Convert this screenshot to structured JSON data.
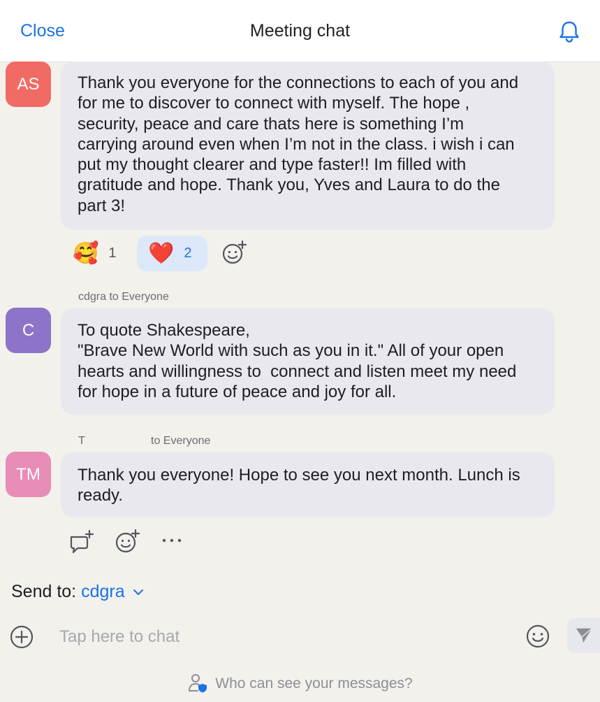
{
  "header": {
    "close_label": "Close",
    "title": "Meeting chat",
    "bell_icon": "bell-icon"
  },
  "messages": [
    {
      "avatar_initials": "AS",
      "avatar_color": "#f26a64",
      "sender": "",
      "lines": [
        "Thank you everyone for the connections to each of you and",
        "for me to discover to connect with myself. The hope ,",
        "security, peace and care thats here is something I’m",
        "carrying around even when I’m not in the class. i wish i can",
        "put my thought clearer and type faster!! Im filled with",
        "gratitude and hope. Thank you, Yves and Laura to do the",
        "part 3!"
      ],
      "reactions": [
        {
          "emoji": "🥰",
          "icon": "smiling-face-with-hearts-icon",
          "count": "1"
        },
        {
          "emoji": "❤️",
          "icon": "red-heart-icon",
          "count": "2"
        }
      ]
    },
    {
      "avatar_initials": "C",
      "avatar_color": "#8e74c9",
      "sender": "cdgra to Everyone",
      "lines": [
        "To quote Shakespeare,",
        "\"Brave New World with such as you in it.\" All of your open",
        "hearts and willingness to  connect and listen meet my need",
        "for hope in a future of peace and joy for all."
      ]
    },
    {
      "avatar_initials": "TM",
      "avatar_color": "#e78db6",
      "sender_initial": "T",
      "sender_suffix": "to Everyone",
      "lines": [
        "Thank you everyone! Hope to see you next month. Lunch is",
        "ready."
      ]
    }
  ],
  "composer": {
    "send_to_label": "Send to:",
    "send_to_target": "cdgra",
    "placeholder": "Tap here to chat",
    "value": ""
  },
  "footer": {
    "privacy_text": "Who can see your messages?"
  },
  "colors": {
    "accent": "#1a73e8",
    "background": "#f3f1ec",
    "bubble": "#e9e8ee",
    "selected_reaction": "#dce8f8"
  }
}
